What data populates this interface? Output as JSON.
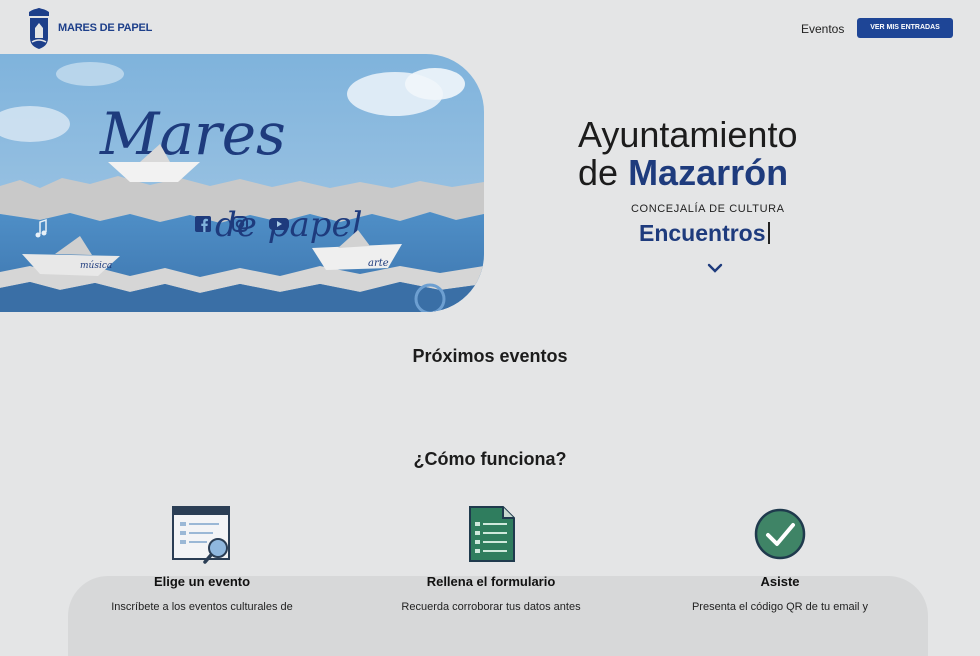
{
  "header": {
    "logo_text": "MARES DE PAPEL",
    "nav_eventos": "Eventos",
    "cta_label": "VER MIS ENTRADAS",
    "accent": "#1e4596"
  },
  "hero": {
    "banner_script_title": "Mares",
    "banner_script_subtitle": "de papel",
    "boat_label_1": "música",
    "boat_label_2": "arte",
    "social_icons": [
      "facebook-icon",
      "instagram-icon",
      "youtube-icon"
    ],
    "title_line1": "Ayuntamiento",
    "title_line2_prefix": "de",
    "title_line2_strong": "Mazarrón",
    "department": "CONCEJALÍA DE CULTURA",
    "rotating_word": "Encuentros"
  },
  "sections": {
    "upcoming_title": "Próximos eventos",
    "how_title": "¿Cómo funciona?"
  },
  "steps": [
    {
      "icon": "event-list-search-icon",
      "title": "Elige un evento",
      "desc": "Inscríbete a los eventos culturales de"
    },
    {
      "icon": "form-document-icon",
      "title": "Rellena el formulario",
      "desc": "Recuerda corroborar tus datos antes"
    },
    {
      "icon": "check-circle-icon",
      "title": "Asiste",
      "desc": "Presenta el código QR de tu email y"
    }
  ]
}
